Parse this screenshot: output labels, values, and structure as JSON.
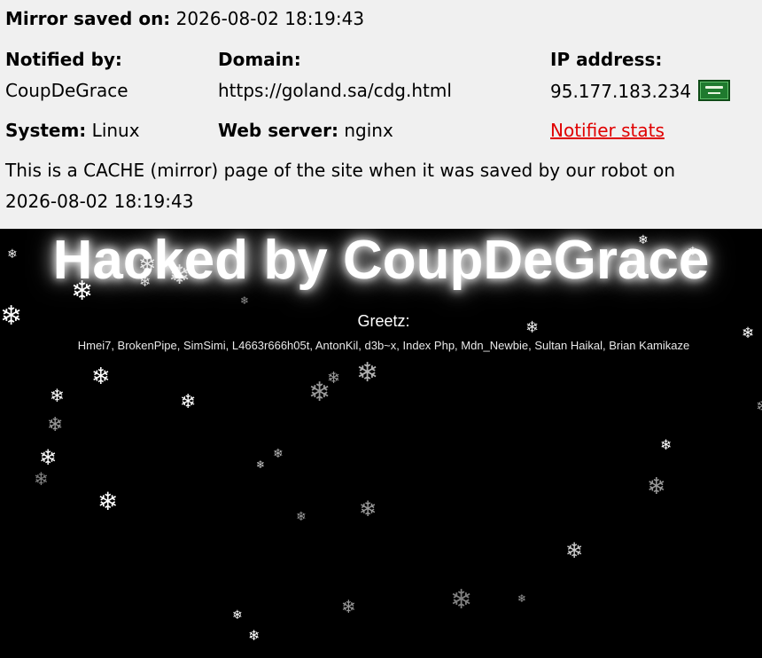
{
  "mirror": {
    "saved_label": "Mirror saved on:",
    "saved_value": "2026-08-02 18:19:43"
  },
  "info": {
    "notified_by_label": "Notified by:",
    "notified_by_value": "CoupDeGrace",
    "domain_label": "Domain:",
    "domain_value": "https://goland.sa/cdg.html",
    "ip_label": "IP address:",
    "ip_value": "95.177.183.234",
    "flag_icon": "saudi-arabia-flag-icon",
    "system_label": "System:",
    "system_value": "Linux",
    "webserver_label": "Web server:",
    "webserver_value": "nginx",
    "notifier_stats_link": "Notifier stats",
    "link_color": "#e00000"
  },
  "cache_notice": {
    "line1": "This is a CACHE (mirror) page of the site when it was saved by our robot on",
    "line2": "2026-08-02 18:19:43"
  },
  "defacement": {
    "headline": "Hacked by CoupDeGrace",
    "greetz_label": "Greetz:",
    "greetz_list": "Hmei7, BrokenPipe, SimSimi, L4663r666h05t, AntonKil, d3b~x, Index Php, Mdn_Newbie, Sultan Haikal, Brian Kamikaze",
    "background_color": "#000000",
    "text_color": "#ffffff",
    "decoration_icon": "snowflake-icon"
  }
}
